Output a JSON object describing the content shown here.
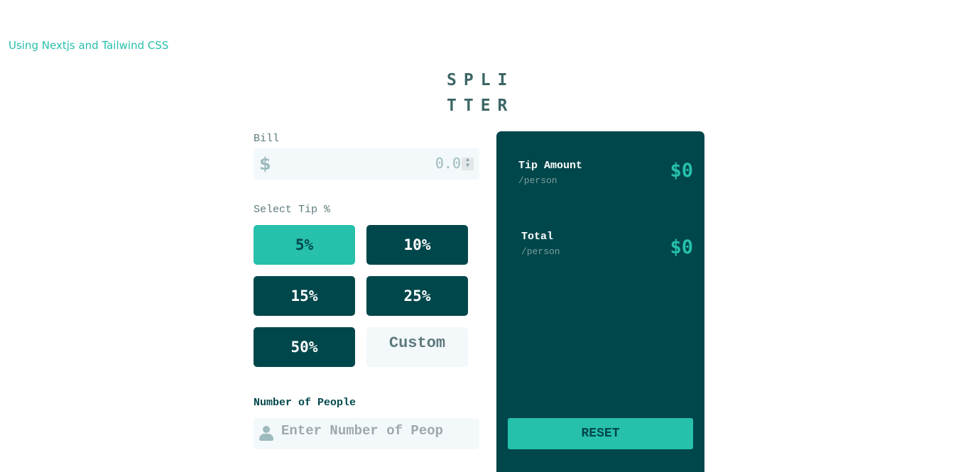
{
  "subtitle": "Using Nextjs and Tailwind CSS",
  "logo": {
    "line1": "SPLI",
    "line2": "TTER"
  },
  "bill": {
    "label": "Bill",
    "currency_icon": "$",
    "value": "0.0"
  },
  "tip": {
    "label": "Select Tip %",
    "options": [
      "5%",
      "10%",
      "15%",
      "25%",
      "50%"
    ],
    "selected": "5%",
    "custom_placeholder": "Custom"
  },
  "people": {
    "label": "Number of People",
    "icon": "person-icon",
    "placeholder": "Enter Number of Peop"
  },
  "results": {
    "tip_amount": {
      "title": "Tip Amount",
      "sub": "/person",
      "value": "$0"
    },
    "total": {
      "title": "Total",
      "sub": "/person",
      "value": "$0"
    },
    "reset_label": "RESET"
  },
  "colors": {
    "accent": "#26c0ab",
    "dark": "#00474b",
    "input_bg": "#f3f8fb"
  }
}
